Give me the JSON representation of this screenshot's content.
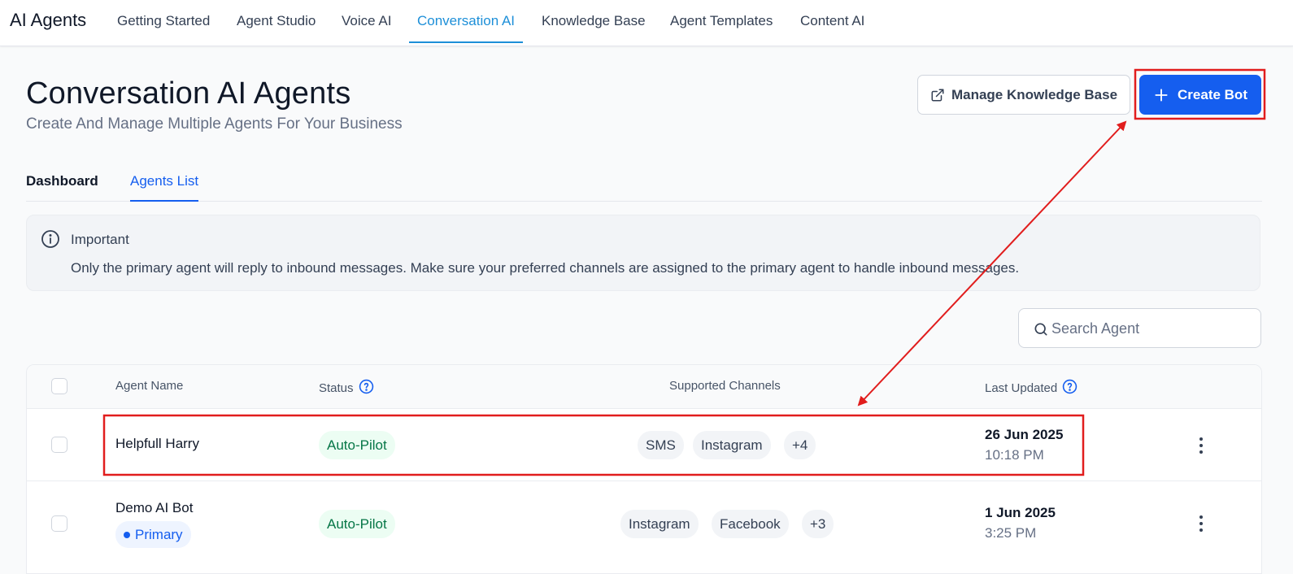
{
  "nav": {
    "brand": "AI Agents",
    "tabs": [
      {
        "label": "Getting Started"
      },
      {
        "label": "Agent Studio"
      },
      {
        "label": "Voice AI"
      },
      {
        "label": "Conversation AI"
      },
      {
        "label": "Knowledge Base"
      },
      {
        "label": "Agent Templates"
      },
      {
        "label": "Content AI"
      }
    ],
    "active_tab": "Conversation AI"
  },
  "header": {
    "title": "Conversation AI Agents",
    "subtitle": "Create And Manage Multiple Agents For Your Business",
    "manage_kb_label": "Manage Knowledge Base",
    "create_bot_label": "Create Bot"
  },
  "subtabs": {
    "dashboard": "Dashboard",
    "agents_list": "Agents List"
  },
  "alert": {
    "title": "Important",
    "body": "Only the primary agent will reply to inbound messages. Make sure your preferred channels are assigned to the primary agent to handle inbound messages."
  },
  "search": {
    "placeholder": "Search Agent"
  },
  "table": {
    "columns": {
      "agent_name": "Agent Name",
      "status": "Status",
      "channels": "Supported Channels",
      "last_updated": "Last Updated"
    },
    "rows": [
      {
        "name": "Helpfull Harry",
        "status": "Auto-Pilot",
        "channels": [
          "SMS",
          "Instagram",
          "+4"
        ],
        "date": "26 Jun 2025",
        "time": "10:18 PM"
      },
      {
        "name": "Demo AI Bot",
        "badge": "Primary",
        "status": "Auto-Pilot",
        "channels": [
          "Instagram",
          "Facebook",
          "+3"
        ],
        "date": "1 Jun 2025",
        "time": "3:25 PM"
      }
    ]
  },
  "colors": {
    "accent": "#155eef",
    "nav_active": "#1d8fd8",
    "status_green": "#067647",
    "annotation_red": "#e11d1d"
  }
}
